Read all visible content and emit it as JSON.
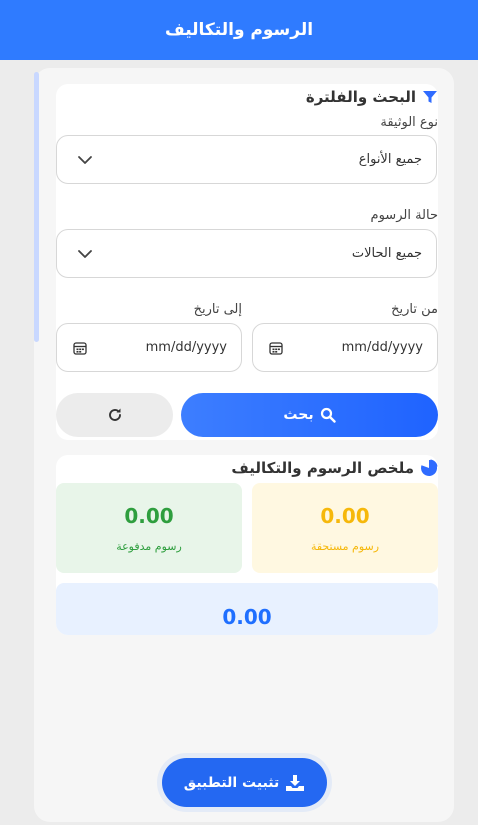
{
  "header": {
    "title": "الرسوم والتكاليف"
  },
  "filter": {
    "title": "البحث والفلترة",
    "doc_type_label": "نوع الوثيقة",
    "doc_type_value": "جميع الأنواع",
    "status_label": "حالة الرسوم",
    "status_value": "جميع الحالات",
    "from_label": "من تاريخ",
    "from_placeholder": "mm/dd/yyyy",
    "to_label": "إلى تاريخ",
    "to_placeholder": "mm/dd/yyyy",
    "search_label": "بحث"
  },
  "summary": {
    "title": "ملخص الرسوم والتكاليف",
    "due_value": "0.00",
    "due_label": "رسوم مستحقة",
    "paid_value": "0.00",
    "paid_label": "رسوم مدفوعة",
    "total_value": "0.00"
  },
  "install": {
    "label": "تثبيت التطبيق"
  },
  "colors": {
    "primary": "#2f7bff",
    "due": "#f6b80b",
    "paid": "#2e9e3e",
    "total": "#1f6fff"
  }
}
